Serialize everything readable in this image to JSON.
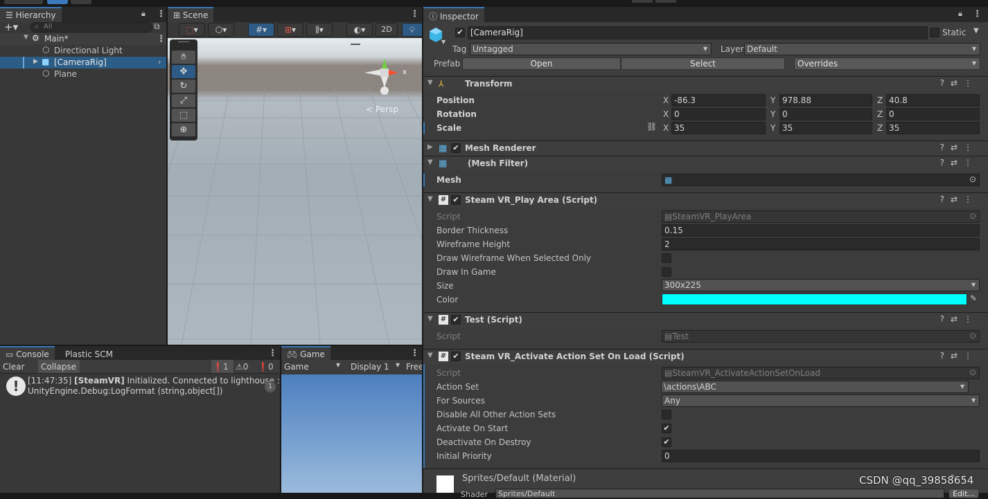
{
  "topbar": {
    "icons": [
      "account-icon",
      "cloud-icon",
      "collab-icon"
    ]
  },
  "hierarchy": {
    "tab": "Hierarchy",
    "search_placeholder": "All",
    "scene": "Main*",
    "items": [
      "Directional Light",
      "[CameraRig]",
      "Plane"
    ]
  },
  "scene": {
    "tab": "Scene",
    "btn_2d": "2D",
    "persp": "< Persp",
    "gizmo_x": "x",
    "tools": [
      "hand-tool",
      "move-tool",
      "rotate-tool",
      "scale-tool",
      "rect-tool",
      "transform-tool"
    ]
  },
  "console": {
    "tabs": [
      "Console",
      "Plastic SCM"
    ],
    "clear": "Clear",
    "collapse": "Collapse",
    "count_info": "1",
    "count_warn": "0",
    "count_error": "0",
    "log_line1_time": "[11:47:35] ",
    "log_line1_tag": "[SteamVR]",
    "log_line1_text": " Initialized. Connected to lighthouse : Vive M",
    "log_line2": "UnityEngine.Debug:LogFormat (string,object[])",
    "badge": "1"
  },
  "game": {
    "tab": "Game",
    "mode": "Game",
    "display": "Display 1",
    "aspect": "Free"
  },
  "inspector": {
    "tab": "Inspector",
    "object_name": "[CameraRig]",
    "static_label": "Static",
    "tag_label": "Tag",
    "tag_value": "Untagged",
    "layer_label": "Layer",
    "layer_value": "Default",
    "prefab_label": "Prefab",
    "open": "Open",
    "select": "Select",
    "overrides": "Overrides",
    "transform": {
      "title": "Transform",
      "position_label": "Position",
      "rotation_label": "Rotation",
      "scale_label": "Scale",
      "position": {
        "x": "-86.3",
        "y": "978.88",
        "z": "40.8"
      },
      "rotation": {
        "x": "0",
        "y": "0",
        "z": "0"
      },
      "scale": {
        "x": "35",
        "y": "35",
        "z": "35"
      },
      "axis_x": "X",
      "axis_y": "Y",
      "axis_z": "Z"
    },
    "mesh_renderer": "Mesh Renderer",
    "mesh_filter": "(Mesh Filter)",
    "mesh_label": "Mesh",
    "play_area": {
      "title": "Steam VR_Play Area (Script)",
      "script_label": "Script",
      "script_value": "SteamVR_PlayArea",
      "border_label": "Border Thickness",
      "border_value": "0.15",
      "wire_label": "Wireframe Height",
      "wire_value": "2",
      "draw_sel_label": "Draw Wireframe When Selected Only",
      "draw_game_label": "Draw In Game",
      "size_label": "Size",
      "size_value": "300x225",
      "color_label": "Color",
      "color_value": "#00ffff"
    },
    "test": {
      "title": "Test (Script)",
      "script_label": "Script",
      "script_value": "Test"
    },
    "activate": {
      "title": "Steam VR_Activate Action Set On Load (Script)",
      "script_label": "Script",
      "script_value": "SteamVR_ActivateActionSetOnLoad",
      "action_set_label": "Action Set",
      "action_set_value": "\\actions\\ABC",
      "for_sources_label": "For Sources",
      "for_sources_value": "Any",
      "disable_label": "Disable All Other Action Sets",
      "activate_label": "Activate On Start",
      "deactivate_label": "Deactivate On Destroy",
      "priority_label": "Initial Priority",
      "priority_value": "0"
    },
    "material": {
      "name": "Sprites/Default (Material)",
      "shader_label": "Shader",
      "shader_value": "Sprites/Default",
      "edit": "Edit..."
    }
  },
  "watermark": "CSDN @qq_39858654",
  "accent": "#3a79bb"
}
